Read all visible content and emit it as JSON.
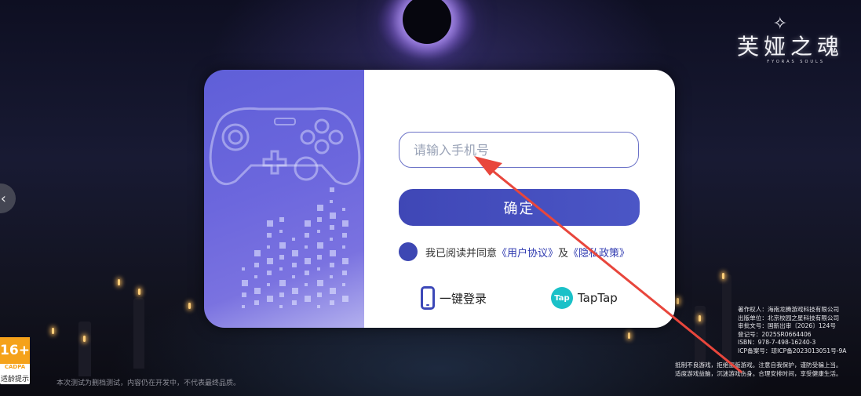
{
  "game": {
    "logo_title": "芙娅之魂",
    "logo_subtitle": "FYORAS SOULS"
  },
  "login": {
    "phone_placeholder": "请输入手机号",
    "confirm_label": "确定",
    "agree_prefix": "我已阅读并同意",
    "user_agreement": "《用户协议》",
    "agree_and": "及",
    "privacy_policy": "《隐私政策》",
    "one_click_login": "一键登录",
    "taptap_icon_text": "Tap",
    "taptap_label": "TapTap"
  },
  "age_rating": {
    "rating": "16+",
    "org": "CADPA",
    "label": "适龄提示"
  },
  "footer": {
    "disclaimer": "本次测试为删档测试，内容仍在开发中，不代表最终品质。",
    "copyright_lines": [
      "著作权人：海南龙腾游戏科技有限公司",
      "出版单位：北京校园之星科技有限公司",
      "审批文号：国新出审〔2026〕124号",
      "登记号：2025SR0664406",
      "ISBN：978-7-498-16240-3",
      "ICP备案号：琼ICP备2023013051号-9A"
    ],
    "health_lines": [
      "抵制不良游戏，拒绝盗版游戏。注意自我保护，谨防受骗上当。",
      "适度游戏益脑，沉迷游戏伤身。合理安排时间，享受健康生活。"
    ]
  },
  "nav": {
    "back_icon": "chevron-left-icon",
    "back_glyph": "‹"
  },
  "colors": {
    "accent": "#3f47b6",
    "annotation_arrow": "#e8463c",
    "taptap": "#1bc1c8",
    "age_badge": "#f5a21a"
  }
}
